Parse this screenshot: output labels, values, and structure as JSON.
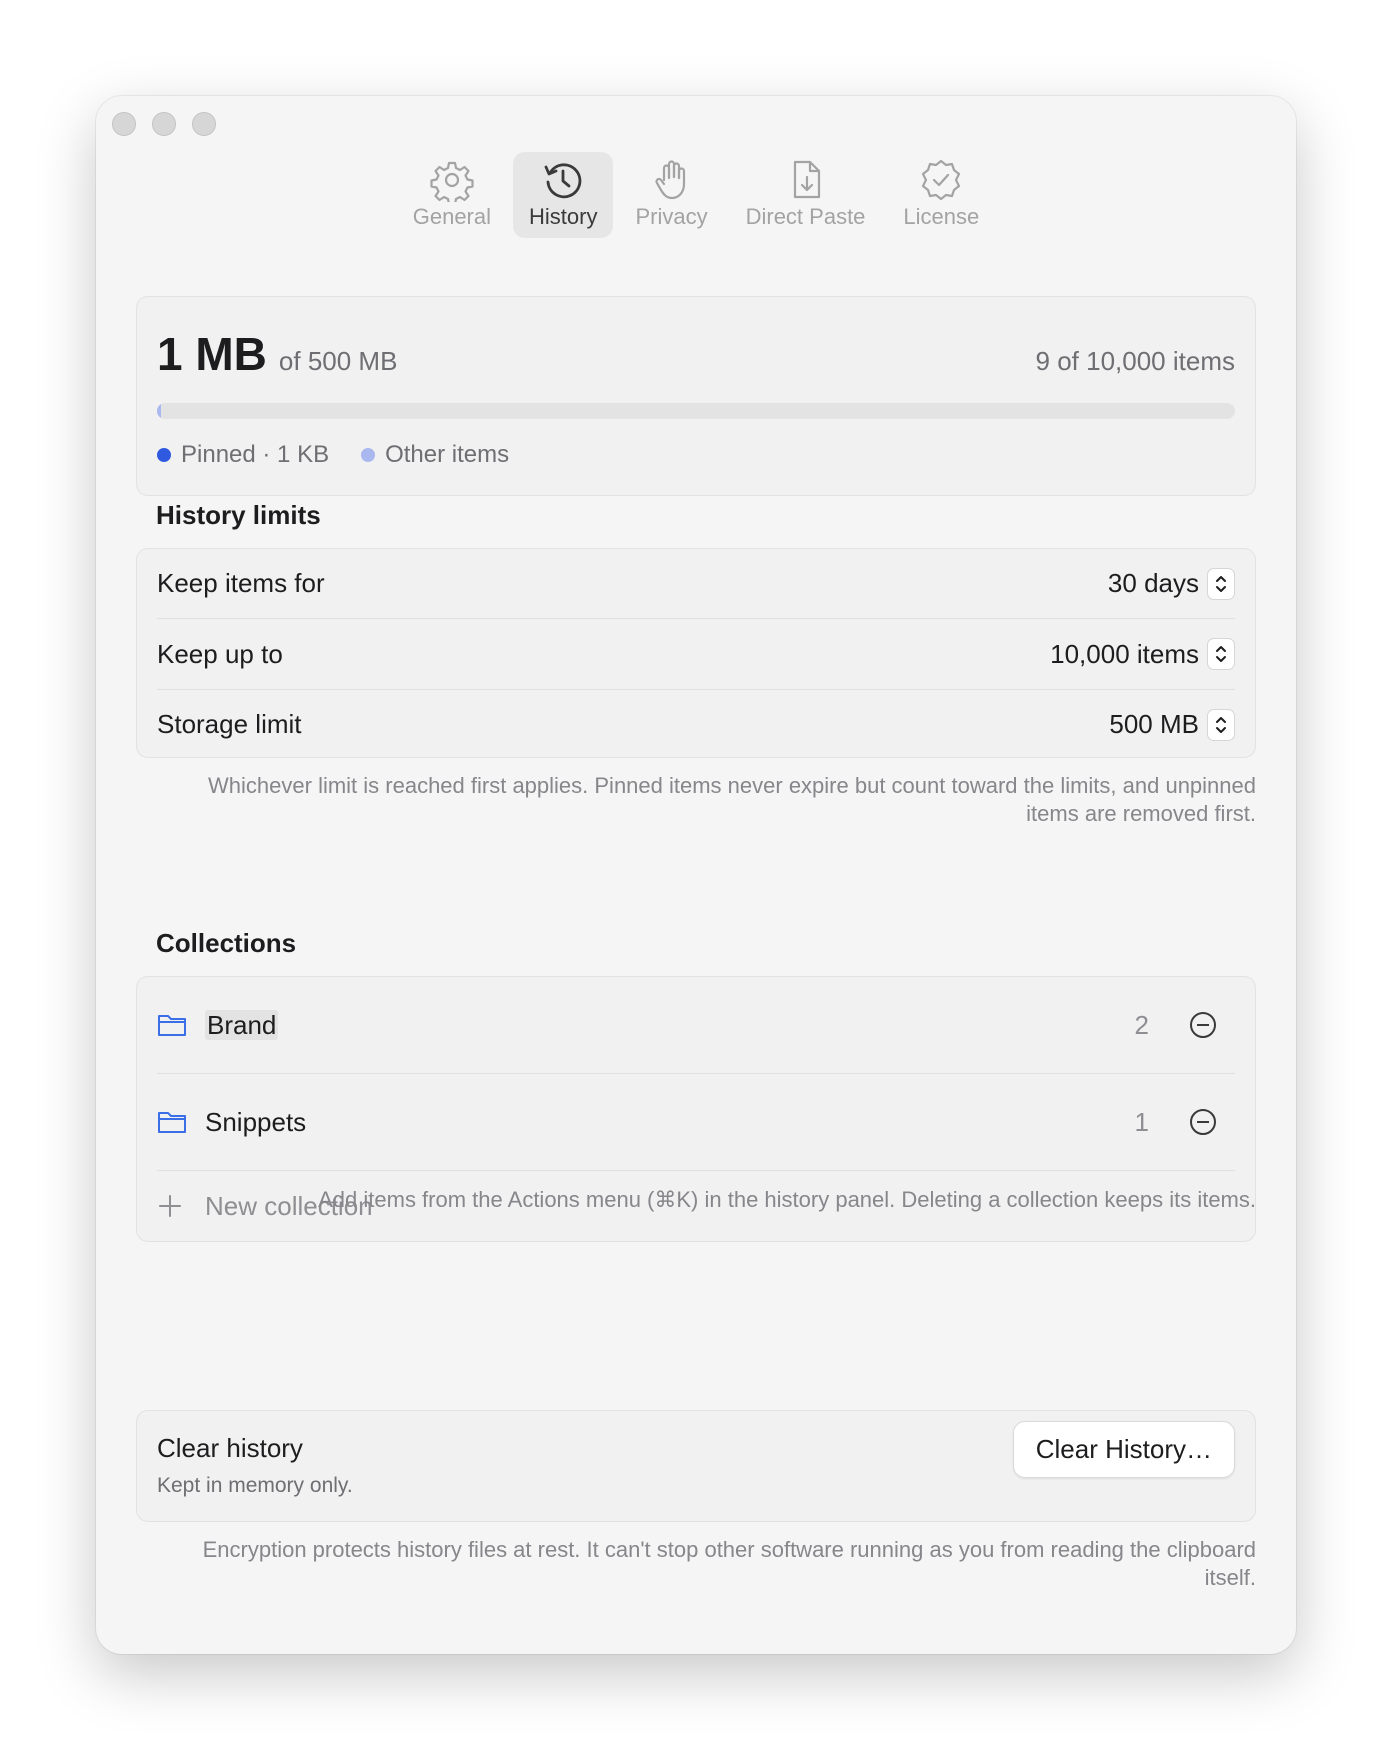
{
  "tabs": [
    {
      "label": "General",
      "icon": "gear-icon",
      "active": false
    },
    {
      "label": "History",
      "icon": "clock-history-icon",
      "active": true
    },
    {
      "label": "Privacy",
      "icon": "hand-icon",
      "active": false
    },
    {
      "label": "Direct Paste",
      "icon": "document-download-icon",
      "active": false
    },
    {
      "label": "License",
      "icon": "checkmark-seal-icon",
      "active": false
    }
  ],
  "usage": {
    "used": "1 MB",
    "of_total": "of 500 MB",
    "items": "9 of 10,000 items",
    "fill_fraction": 0.003,
    "legend": [
      {
        "label": "Pinned · 1 KB",
        "color": "#2f5ae0"
      },
      {
        "label": "Other items",
        "color": "#a9b8ef"
      }
    ]
  },
  "history_limits": {
    "title": "History limits",
    "rows": [
      {
        "label": "Keep items for",
        "value": "30 days"
      },
      {
        "label": "Keep up to",
        "value": "10,000 items"
      },
      {
        "label": "Storage limit",
        "value": "500 MB"
      }
    ],
    "note": "Whichever limit is reached first applies. Pinned items never expire but count toward the limits, and unpinned items are removed first."
  },
  "collections": {
    "title": "Collections",
    "items": [
      {
        "name": "Brand",
        "count": "2"
      },
      {
        "name": "Snippets",
        "count": "1"
      }
    ],
    "new_label": "New collection",
    "note": "Add items from the Actions menu (⌘K) in the history panel. Deleting a collection keeps its items."
  },
  "clear_history": {
    "title": "Clear history",
    "subtitle": "Kept in memory only.",
    "button": "Clear History…",
    "note": "Encryption protects history files at rest. It can't stop other software running as you from reading the clipboard itself."
  },
  "colors": {
    "accent": "#2f5ae0",
    "folder": "#3a6fe8"
  }
}
